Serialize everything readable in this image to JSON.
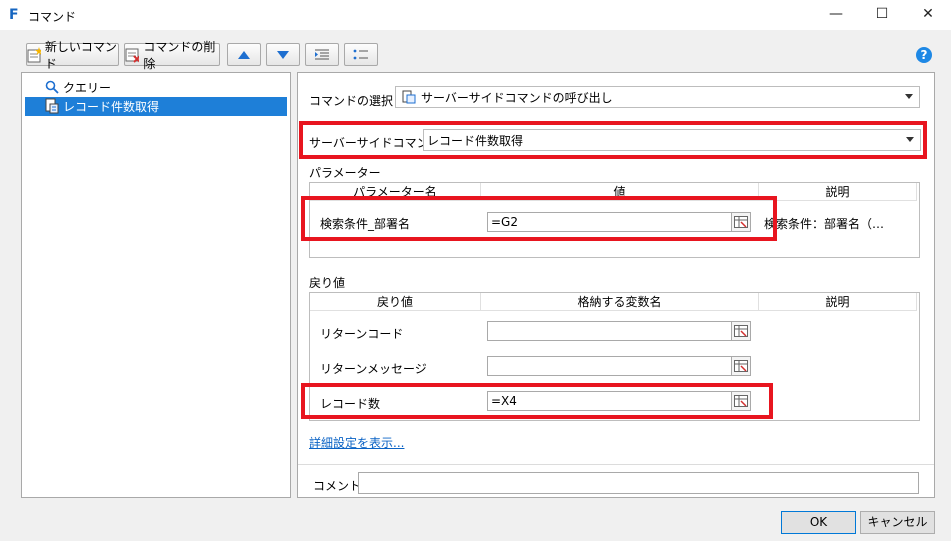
{
  "window": {
    "title": "コマンド",
    "minimize": "—",
    "maximize": "☐",
    "close": "✕"
  },
  "toolbar": {
    "new_command": "新しいコマンド",
    "delete_command": "コマンドの削除"
  },
  "tree": {
    "items": [
      {
        "label": "クエリー"
      },
      {
        "label": "レコード件数取得"
      }
    ]
  },
  "panel": {
    "command_select_label": "コマンドの選択：",
    "command_select_value": "サーバーサイドコマンドの呼び出し",
    "server_command_label": "サーバーサイドコマンド：",
    "server_command_value": "レコード件数取得",
    "params_label": "パラメーター",
    "params_headers": [
      "パラメーター名",
      "値",
      "説明"
    ],
    "params_row": {
      "name": "検索条件_部署名",
      "value": "=G2",
      "desc": "検索条件：部署名（…"
    },
    "returns_label": "戻り値",
    "returns_headers": [
      "戻り値",
      "格納する変数名",
      "説明"
    ],
    "returns_rows": [
      {
        "name": "リターンコード",
        "value": ""
      },
      {
        "name": "リターンメッセージ",
        "value": ""
      },
      {
        "name": "レコード数",
        "value": "=X4"
      }
    ],
    "advanced_link": "詳細設定を表示...",
    "comment_label": "コメント",
    "comment_value": ""
  },
  "buttons": {
    "ok": "OK",
    "cancel": "キャンセル"
  },
  "colors": {
    "highlight": "#e8151f",
    "selection": "#1e7fd8",
    "accent": "#1e88e5"
  }
}
